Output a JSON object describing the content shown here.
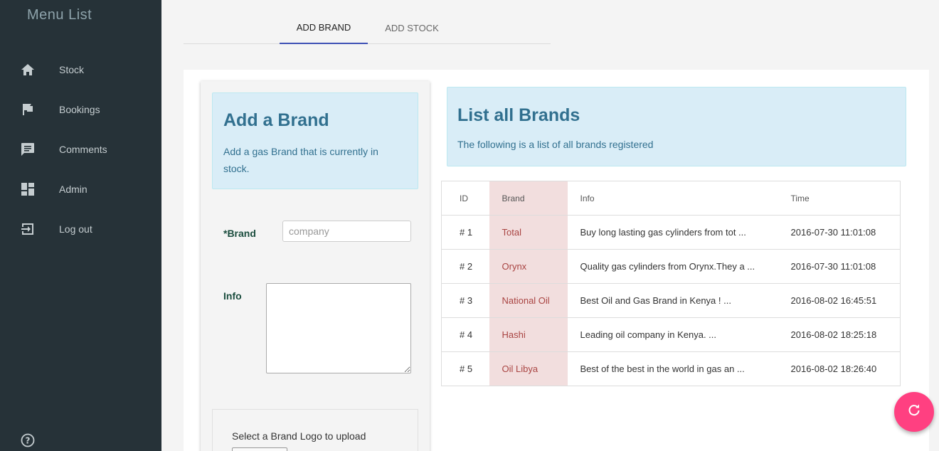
{
  "sidebar": {
    "title": "Menu List",
    "items": [
      {
        "label": "Stock",
        "icon": "home-icon"
      },
      {
        "label": "Bookings",
        "icon": "flag-icon"
      },
      {
        "label": "Comments",
        "icon": "comment-icon"
      },
      {
        "label": "Admin",
        "icon": "dashboard-icon"
      },
      {
        "label": "Log out",
        "icon": "logout-icon"
      }
    ],
    "help_icon": "help-icon"
  },
  "tabs": [
    {
      "label": "ADD BRAND",
      "active": true
    },
    {
      "label": "ADD STOCK",
      "active": false
    }
  ],
  "add_brand": {
    "title": "Add a Brand",
    "subtitle": "Add a gas Brand that is currently in stock.",
    "brand_label": "*Brand",
    "brand_placeholder": "company",
    "brand_value": "",
    "info_label": "Info",
    "info_value": "",
    "upload_label": "Select a Brand Logo to upload"
  },
  "list_brands": {
    "title": "List all Brands",
    "subtitle": "The following is a list of all brands registered",
    "columns": [
      "ID",
      "Brand",
      "Info",
      "Time"
    ],
    "rows": [
      {
        "id": "# 1",
        "brand": "Total",
        "info": "Buy long lasting gas cylinders from tot ...",
        "time": "2016-07-30 11:01:08"
      },
      {
        "id": "# 2",
        "brand": "Orynx",
        "info": "Quality gas cylinders from Orynx.They a ...",
        "time": "2016-07-30 11:01:08"
      },
      {
        "id": "# 3",
        "brand": "National Oil",
        "info": "Best Oil and Gas Brand in Kenya ! ...",
        "time": "2016-08-02 16:45:51"
      },
      {
        "id": "# 4",
        "brand": "Hashi",
        "info": "Leading oil company in Kenya. ...",
        "time": "2016-08-02 18:25:18"
      },
      {
        "id": "# 5",
        "brand": "Oil Libya",
        "info": "Best of the best in the world in gas an ...",
        "time": "2016-08-02 18:26:40"
      }
    ]
  },
  "fab": {
    "icon": "refresh-icon"
  },
  "colors": {
    "sidebar_bg": "#263238",
    "accent": "#3f51b5",
    "fab": "#ff4081",
    "info_box_bg": "#d9edf7",
    "info_text": "#31708f",
    "brand_col_bg": "#f2dede",
    "brand_col_text": "#a94442"
  }
}
